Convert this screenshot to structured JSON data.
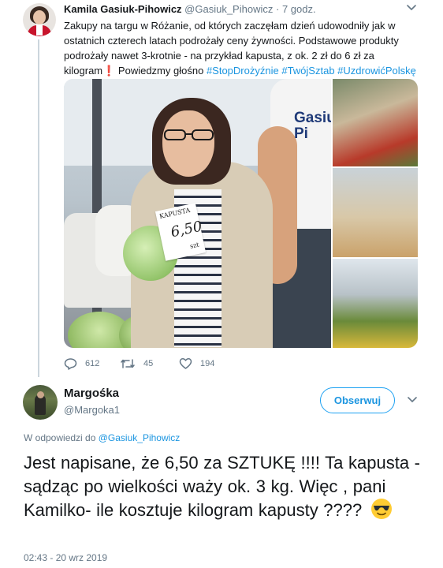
{
  "tweet1": {
    "author_name": "Kamila Gasiuk-Pihowicz",
    "author_handle": "@Gasiuk_Pihowicz",
    "separator": "·",
    "time_ago": "7 godz.",
    "text_line1": "Zakupy na targu w Różanie, od których zaczęłam dzień udowodniły jak w",
    "text_line2": "ostatnich czterech latach podrożały ceny żywności. Podstawowe produkty",
    "text_line3": "podrożały nawet 3-krotnie - na przykład kapusta, z ok. 2 zł do 6 zł za",
    "text_line4_start": "kilogram",
    "text_line4_emoji": "❗",
    "text_line4_mid": " Powiedzmy głośno ",
    "hashtags": [
      "#StopDrożyźnie",
      "#TwójSztab",
      "#UzdrowićPolskę"
    ],
    "photo_shirt_text": "Gasiuk Pi",
    "photo_sign_label": "KAPUSTA",
    "photo_sign_price": "6,50",
    "photo_sign_unit": "szt",
    "stats": {
      "replies": "612",
      "retweets": "45",
      "likes": "194"
    },
    "icons": {
      "reply": "reply-icon",
      "retweet": "retweet-icon",
      "like": "heart-icon",
      "caret": "chevron-down-icon"
    }
  },
  "tweet2": {
    "author_name": "Margośka",
    "author_handle": "@Margoka1",
    "follow_label": "Obserwuj",
    "reply_prefix": "W odpowiedzi do",
    "reply_mention": "@Gasiuk_Pihowicz",
    "text": "Jest napisane, że 6,50 za SZTUKĘ !!!! Ta kapusta - sądząc po wielkości waży ok. 3 kg. Więc , pani Kamilko- ile kosztuje kilogram kapusty ????",
    "emoji": "smiling-face-with-sunglasses",
    "timestamp": "02:43 - 20 wrz 2019"
  },
  "colors": {
    "link": "#1b95e0",
    "secondary_text": "#657786",
    "primary_text": "#14171a",
    "thread_line": "#ccd6dd",
    "follow_border": "#1da1f2"
  }
}
